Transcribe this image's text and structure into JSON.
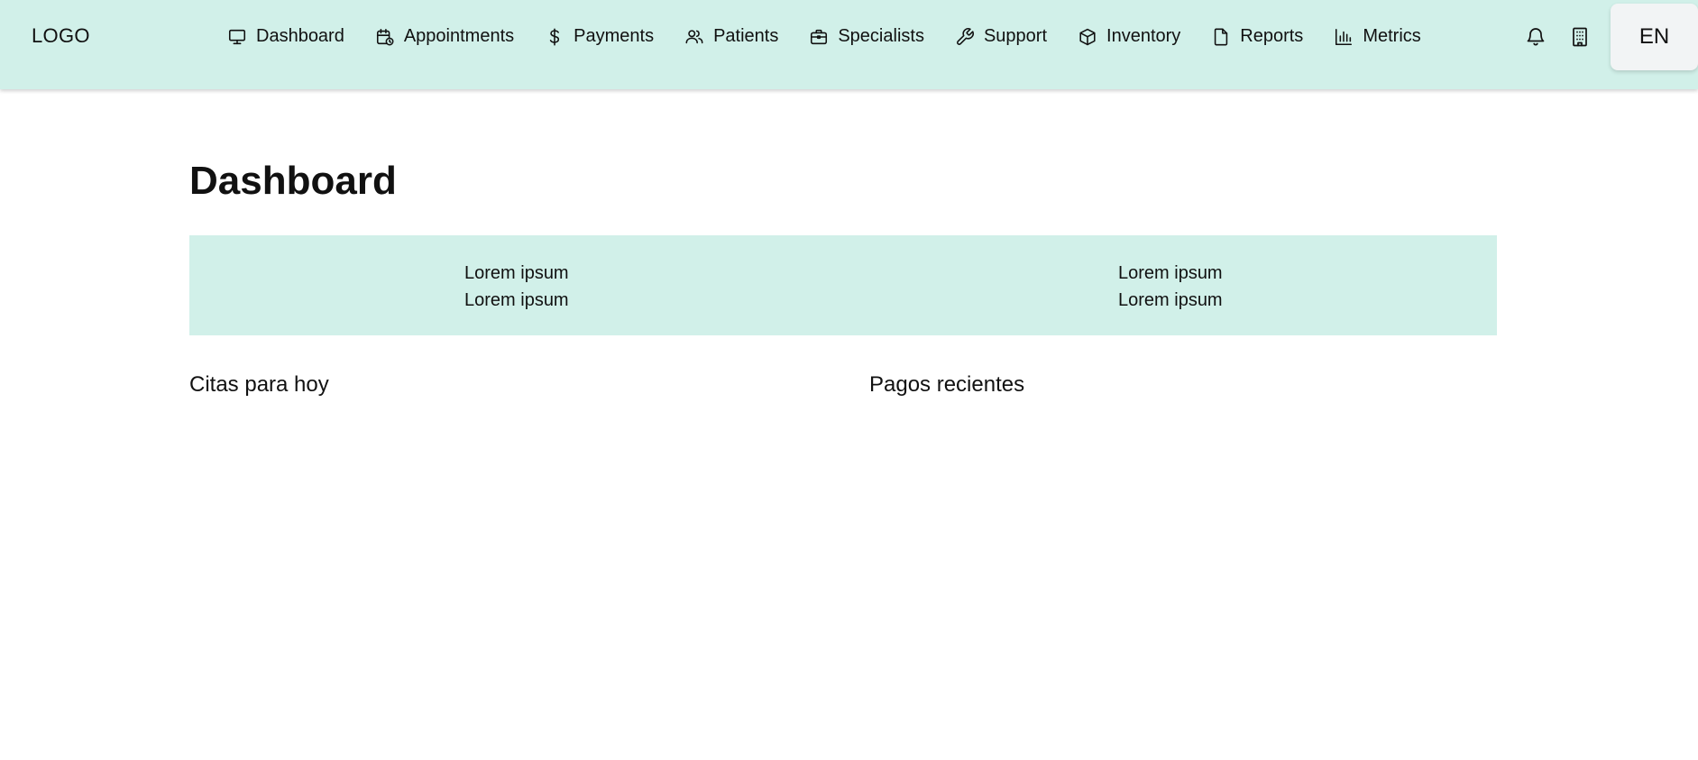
{
  "header": {
    "logo": "LOGO",
    "nav": [
      {
        "label": "Dashboard",
        "icon": "monitor-icon"
      },
      {
        "label": "Appointments",
        "icon": "calendar-clock-icon"
      },
      {
        "label": "Payments",
        "icon": "dollar-icon"
      },
      {
        "label": "Patients",
        "icon": "users-icon"
      },
      {
        "label": "Specialists",
        "icon": "briefcase-icon"
      },
      {
        "label": "Support",
        "icon": "wrench-icon"
      },
      {
        "label": "Inventory",
        "icon": "box-icon"
      },
      {
        "label": "Reports",
        "icon": "file-icon"
      },
      {
        "label": "Metrics",
        "icon": "bar-chart-icon"
      }
    ],
    "notifications_icon": "bell-icon",
    "building_icon": "building-icon",
    "language": "EN"
  },
  "main": {
    "title": "Dashboard",
    "summary": {
      "col1": {
        "line1": "Lorem ipsum",
        "line2": "Lorem ipsum"
      },
      "col2": {
        "line1": "Lorem ipsum",
        "line2": "Lorem ipsum"
      }
    },
    "sections": {
      "appointments_title": "Citas para hoy",
      "payments_title": "Pagos recientes"
    }
  },
  "colors": {
    "header_bg": "#d1f0e9",
    "panel_bg": "#d1f0e9",
    "lang_bg": "#f2f4f5"
  }
}
